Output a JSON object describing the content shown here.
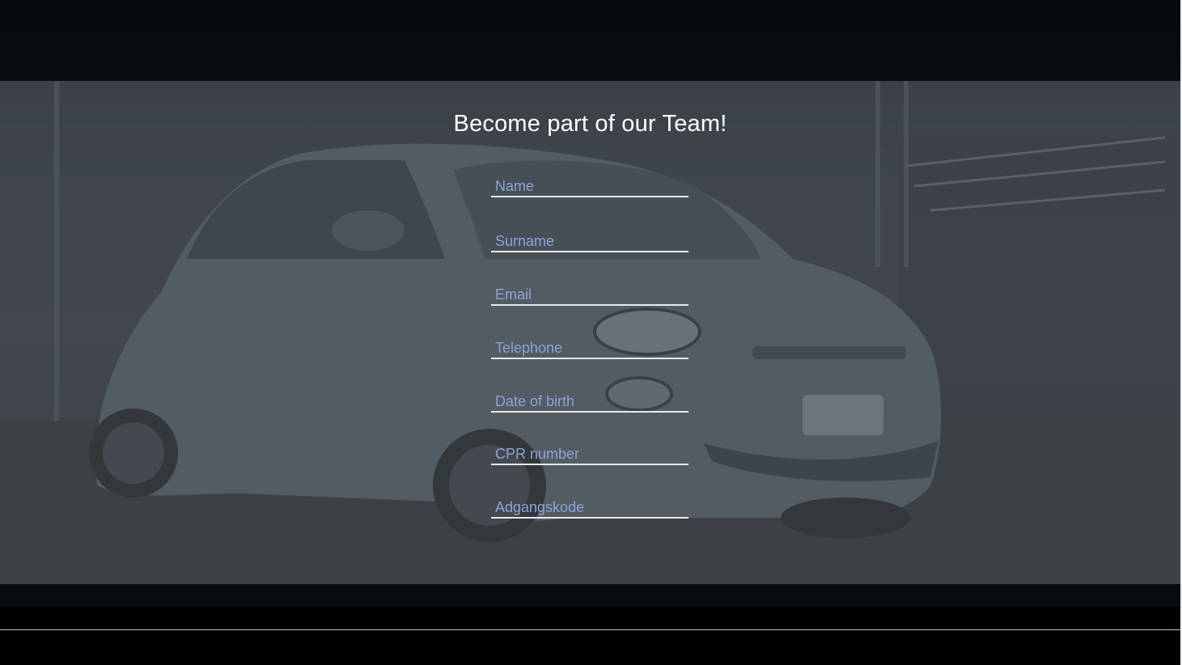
{
  "form": {
    "title": "Become part of our Team!",
    "fields": [
      {
        "placeholder": "Name"
      },
      {
        "placeholder": "Surname"
      },
      {
        "placeholder": "Email"
      },
      {
        "placeholder": "Telephone"
      },
      {
        "placeholder": "Date of birth"
      },
      {
        "placeholder": "CPR number"
      },
      {
        "placeholder": "Adgangskode"
      }
    ]
  },
  "colors": {
    "title": "#ffffff",
    "placeholder": "#8da2d8",
    "underline": "#e8e8e8",
    "overlay": "#50565c"
  }
}
